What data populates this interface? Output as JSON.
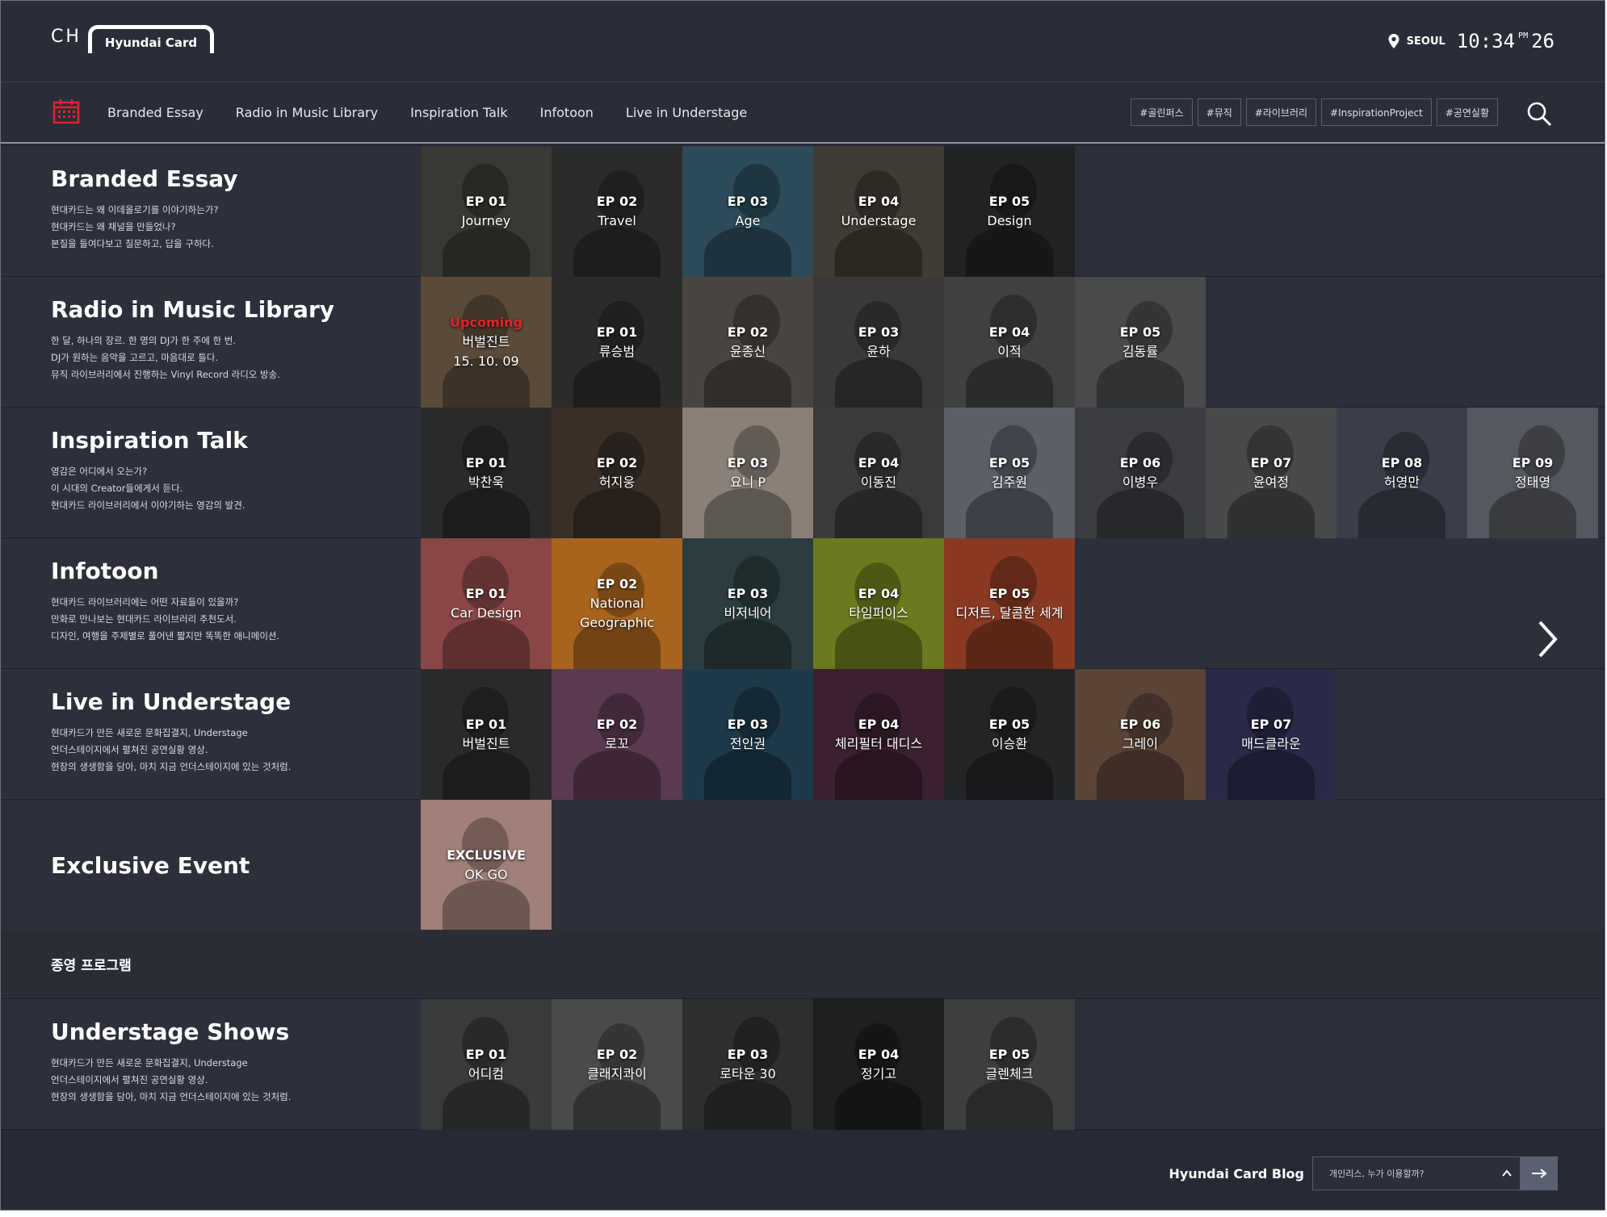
{
  "header": {
    "logo_ch": "CH",
    "logo_brand": "Hyundai Card",
    "city": "SEOUL",
    "time": "10:34",
    "ampm": "PM",
    "day": "26"
  },
  "nav": {
    "items": [
      "Branded Essay",
      "Radio in Music Library",
      "Inspiration Talk",
      "Infotoon",
      "Live in Understage"
    ],
    "tags": [
      "#골린퍼스",
      "#뮤직",
      "#라이브러리",
      "#InspirationProject",
      "#공연실황"
    ]
  },
  "rows": [
    {
      "title": "Branded Essay",
      "desc": [
        "현대카드는 왜 이데올로기를 이야기하는가?",
        "현대카드는 왜 채널을 만들었나?",
        "본질을 들여다보고 질문하고, 답을 구하다."
      ],
      "tiles": [
        {
          "ep": "EP 01",
          "name": "Journey"
        },
        {
          "ep": "EP 02",
          "name": "Travel"
        },
        {
          "ep": "EP 03",
          "name": "Age"
        },
        {
          "ep": "EP 04",
          "name": "Understage"
        },
        {
          "ep": "EP 05",
          "name": "Design"
        }
      ]
    },
    {
      "title": "Radio in Music Library",
      "desc": [
        "한 달, 하나의 장르. 한 명의 DJ가 한 주에 한 번.",
        "DJ가 원하는 음악을 고르고, 마음대로 틀다.",
        "뮤직 라이브러리에서 진행하는 Vinyl Record 라디오 방송."
      ],
      "tiles": [
        {
          "ep": "Upcoming",
          "name": "버벌진트",
          "extra": "15. 10. 09"
        },
        {
          "ep": "EP 01",
          "name": "류승범"
        },
        {
          "ep": "EP 02",
          "name": "윤종신"
        },
        {
          "ep": "EP 03",
          "name": "윤하"
        },
        {
          "ep": "EP 04",
          "name": "이적"
        },
        {
          "ep": "EP 05",
          "name": "김동률"
        }
      ]
    },
    {
      "title": "Inspiration Talk",
      "desc": [
        "영감은 어디에서 오는가?",
        "이 시대의 Creator들에게서 듣다.",
        "현대카드 라이브러리에서 이야기하는 영감의 발견."
      ],
      "tiles": [
        {
          "ep": "EP 01",
          "name": "박찬욱"
        },
        {
          "ep": "EP 02",
          "name": "허지웅"
        },
        {
          "ep": "EP 03",
          "name": "요니 P"
        },
        {
          "ep": "EP 04",
          "name": "이동진"
        },
        {
          "ep": "EP 05",
          "name": "김주원"
        },
        {
          "ep": "EP 06",
          "name": "이병우"
        },
        {
          "ep": "EP 07",
          "name": "윤여정"
        },
        {
          "ep": "EP 08",
          "name": "허영만"
        },
        {
          "ep": "EP 09",
          "name": "정태영"
        }
      ]
    },
    {
      "title": "Infotoon",
      "desc": [
        "현대카드 라이브러리에는 어떤 자료들이 있을까?",
        "만화로 만나보는 현대카드 라이브러리 추천도서.",
        "디자인, 여행을 주제별로 풀어낸 짧지만 똑똑한 애니메이션."
      ],
      "tiles": [
        {
          "ep": "EP 01",
          "name": "Car Design"
        },
        {
          "ep": "EP 02",
          "name": "National Geographic"
        },
        {
          "ep": "EP 03",
          "name": "비저네어"
        },
        {
          "ep": "EP 04",
          "name": "타임퍼이스"
        },
        {
          "ep": "EP 05",
          "name": "디저트, 달콤한 세계"
        }
      ]
    },
    {
      "title": "Live in Understage",
      "desc": [
        "현대카드가 만든 새로운 문화집결지, Understage",
        "언더스테이지에서 펼쳐진 공연실황 영상.",
        "현장의 생생함을 담아, 마치 지금 언더스테이지에 있는 것처럼."
      ],
      "tiles": [
        {
          "ep": "EP 01",
          "name": "버벌진트"
        },
        {
          "ep": "EP 02",
          "name": "로꼬"
        },
        {
          "ep": "EP 03",
          "name": "전인권"
        },
        {
          "ep": "EP 04",
          "name": "체리필터 대디스"
        },
        {
          "ep": "EP 05",
          "name": "이승환"
        },
        {
          "ep": "EP 06",
          "name": "그레이"
        },
        {
          "ep": "EP 07",
          "name": "매드클라운"
        }
      ]
    },
    {
      "title": "Exclusive Event",
      "desc": [],
      "tiles": [
        {
          "ep": "EXCLUSIVE",
          "name": "OK GO"
        }
      ]
    }
  ],
  "divider": "종영 프로그램",
  "ended": {
    "title": "Understage Shows",
    "desc": [
      "현대카드가 만든 새로운 문화집결지, Understage",
      "언더스테이지에서 펼쳐진 공연실황 영상.",
      "현장의 생생함을 담아, 마치 지금 언더스테이지에 있는 것처럼."
    ],
    "tiles": [
      {
        "ep": "EP 01",
        "name": "어디컴"
      },
      {
        "ep": "EP 02",
        "name": "클래지콰이"
      },
      {
        "ep": "EP 03",
        "name": "로타운 30"
      },
      {
        "ep": "EP 04",
        "name": "정기고"
      },
      {
        "ep": "EP 05",
        "name": "글렌체크"
      }
    ]
  },
  "footer": {
    "blog_label": "Hyundai Card Blog",
    "blog_select": "개인리스, 누가 이용할까?"
  },
  "colors": {
    "background": "#272a34",
    "row": "#2d303a",
    "calendar_accent": "#e0242a",
    "upcoming": "#e0242a"
  },
  "icons": [
    "location-pin-icon",
    "calendar-icon",
    "search-icon",
    "chevron-right-icon",
    "chevron-up-icon",
    "arrow-right-icon"
  ]
}
